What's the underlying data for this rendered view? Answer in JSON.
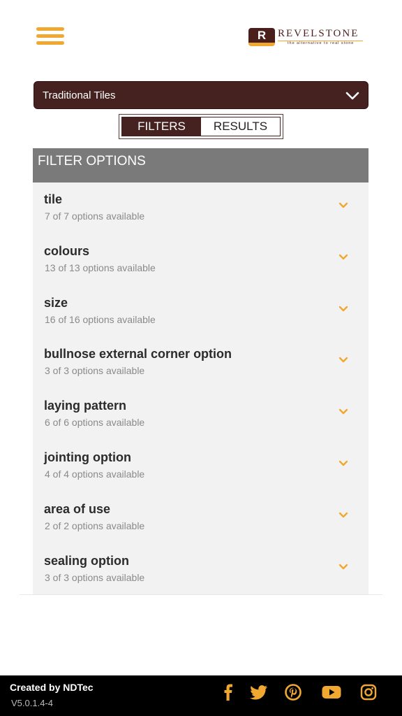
{
  "header": {
    "brand_name": "REVELSTONE",
    "brand_tagline": "the alternative to real stone",
    "logo_mark": "R"
  },
  "category_select": {
    "value": "Traditional Tiles"
  },
  "view_toggle": {
    "filters_label": "FILTERS",
    "results_label": "RESULTS",
    "active": "FILTERS"
  },
  "filter_panel": {
    "title": "FILTER OPTIONS",
    "items": [
      {
        "name": "tile",
        "count": "7 of 7 options available"
      },
      {
        "name": "colours",
        "count": "13 of 13 options available"
      },
      {
        "name": "size",
        "count": "16 of 16 options available"
      },
      {
        "name": "bullnose external corner option",
        "count": "3 of 3 options available"
      },
      {
        "name": "laying pattern",
        "count": "6 of 6 options available"
      },
      {
        "name": "jointing option",
        "count": "4 of 4 options available"
      },
      {
        "name": "area of use",
        "count": "2 of 2 options available"
      },
      {
        "name": "sealing option",
        "count": "3 of 3 options available"
      }
    ]
  },
  "footer": {
    "credit": "Created by NDTec",
    "version": "V5.0.1.4-4",
    "social_icons": [
      "facebook-icon",
      "twitter-icon",
      "pinterest-icon",
      "youtube-icon",
      "instagram-icon"
    ]
  },
  "colors": {
    "accent": "#f0a830",
    "brand_dark": "#452220",
    "panel_header": "#7a7a7a",
    "panel_bg": "#f2f2f2",
    "footer_bg": "#000000"
  }
}
